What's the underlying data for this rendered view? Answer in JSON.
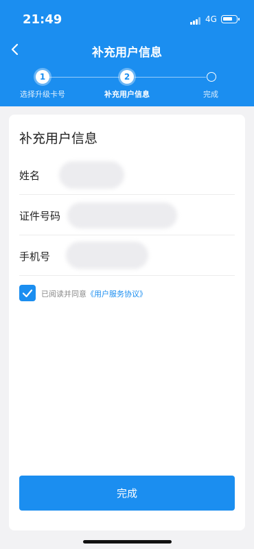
{
  "status_bar": {
    "time": "21:49",
    "network": "4G"
  },
  "nav": {
    "title": "补充用户信息"
  },
  "steps": [
    {
      "number": "1",
      "label": "选择升级卡号"
    },
    {
      "number": "2",
      "label": "补充用户信息"
    },
    {
      "number": "",
      "label": "完成"
    }
  ],
  "form": {
    "title": "补充用户信息",
    "fields": [
      {
        "label": "姓名"
      },
      {
        "label": "证件号码"
      },
      {
        "label": "手机号"
      }
    ],
    "agreement": {
      "text": "已阅读并同意",
      "link": "《用户服务协议》",
      "checked": true
    }
  },
  "submit": {
    "label": "完成"
  },
  "colors": {
    "primary": "#1b8ef0",
    "background": "#f2f2f4"
  }
}
